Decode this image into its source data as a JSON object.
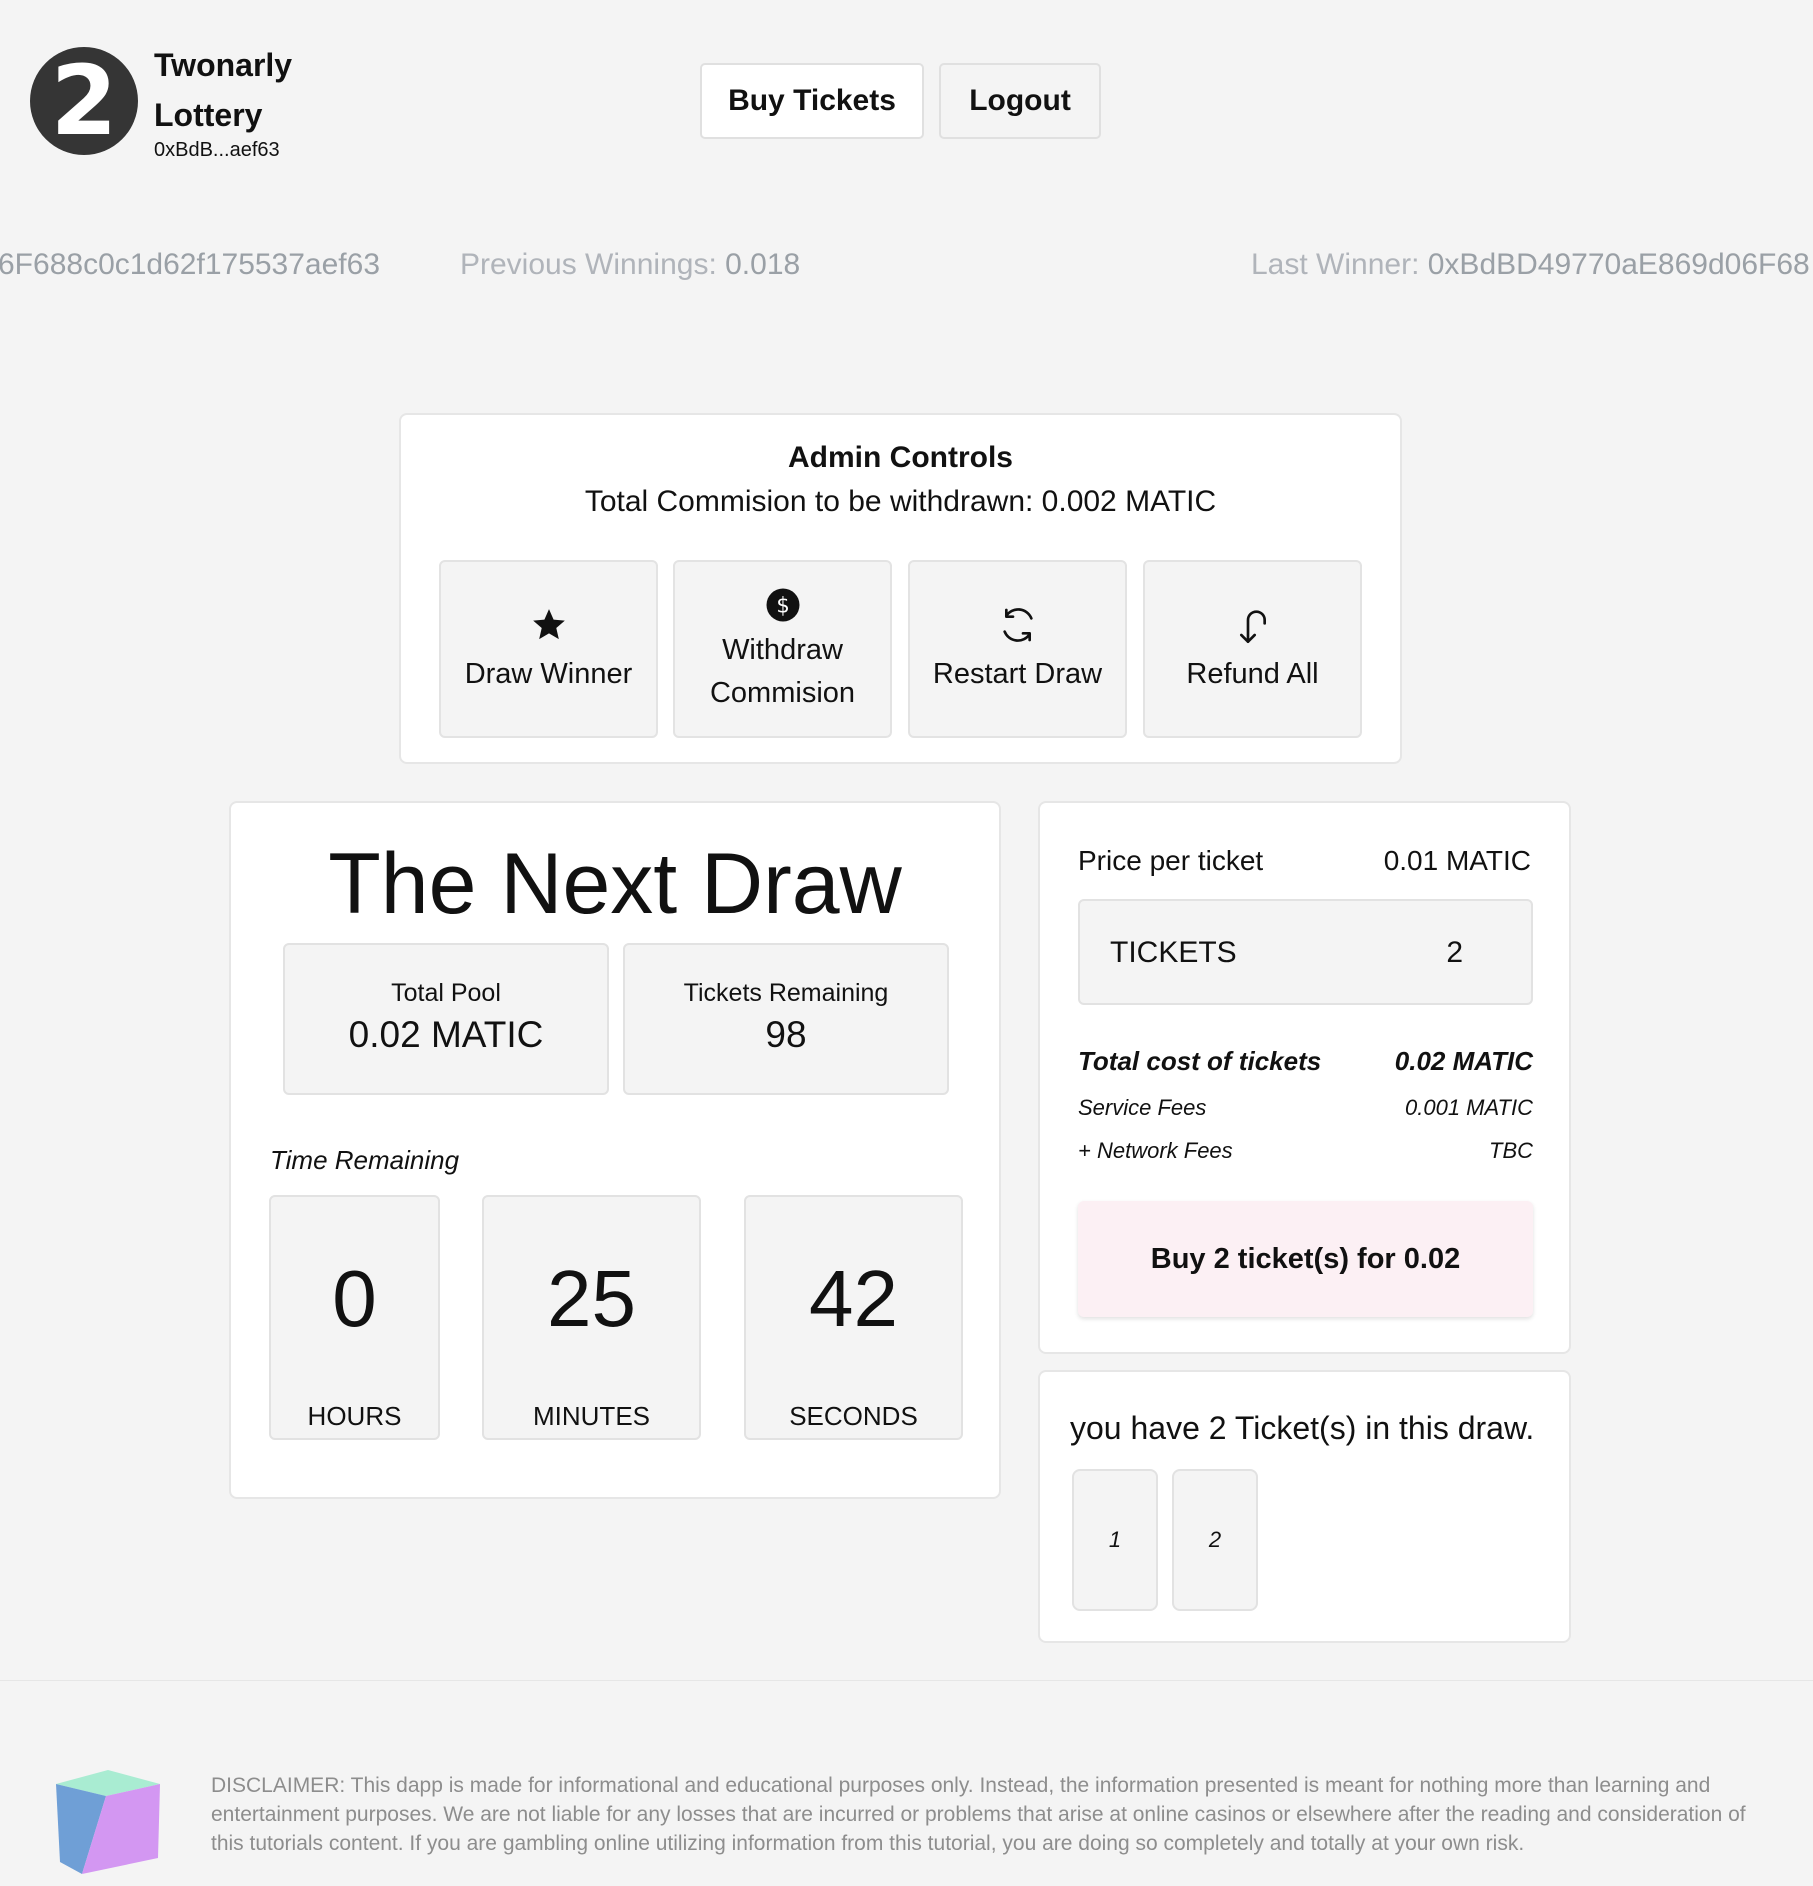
{
  "header": {
    "logo_glyph": "2",
    "app_name": "Twonarly Lottery",
    "account_short": "0xBdB...aef63",
    "buy_tickets_label": "Buy Tickets",
    "logout_label": "Logout"
  },
  "ticker": {
    "address_fragment": "6F688c0c1d62f175537aef63",
    "prev_winnings_label": "Previous Winnings:",
    "prev_winnings_value": "0.018",
    "last_winner_label": "Last Winner:",
    "last_winner_value": "0xBdBD49770aE869d06F68"
  },
  "admin": {
    "title": "Admin Controls",
    "commission_text": "Total Commision to be withdrawn: 0.002 MATIC",
    "buttons": [
      {
        "label": "Draw Winner",
        "icon": "star-icon"
      },
      {
        "label": "Withdraw Commision",
        "icon": "dollar-coin-icon"
      },
      {
        "label": "Restart Draw",
        "icon": "refresh-icon"
      },
      {
        "label": "Refund All",
        "icon": "undo-arrow-icon"
      }
    ]
  },
  "draw": {
    "title": "The Next Draw",
    "total_pool_label": "Total Pool",
    "total_pool_value": "0.02 MATIC",
    "tickets_remaining_label": "Tickets Remaining",
    "tickets_remaining_value": "98",
    "time_remaining_label": "Time Remaining",
    "hours": "0",
    "hours_label": "HOURS",
    "minutes": "25",
    "minutes_label": "MINUTES",
    "seconds": "42",
    "seconds_label": "SECONDS"
  },
  "purchase": {
    "price_label": "Price per ticket",
    "price_value": "0.01 MATIC",
    "tickets_label": "TICKETS",
    "tickets_value": "2",
    "total_cost_label": "Total cost of tickets",
    "total_cost_value": "0.02 MATIC",
    "service_fees_label": "Service Fees",
    "service_fees_value": "0.001 MATIC",
    "network_fees_label": "+ Network Fees",
    "network_fees_value": "TBC",
    "buy_button_label": "Buy 2 ticket(s) for 0.02"
  },
  "my_tickets": {
    "summary": "you have 2 Ticket(s) in this draw.",
    "tickets": [
      "1",
      "2"
    ]
  },
  "footer": {
    "disclaimer": "DISCLAIMER: This dapp is made for informational and educational purposes only. Instead, the information presented is meant for nothing more than learning and entertainment purposes. We are not liable for any losses that are incurred or problems that arise at online casinos or elsewhere after the reading and consideration of this tutorials content. If you are gambling online utilizing information from this tutorial, you are doing so completely and totally at your own risk."
  },
  "colors": {
    "background": "#f4f4f4",
    "logo_circle": "#353535",
    "buy_button_bg": "#fcf0f4",
    "ticker_text": "#b0b4ba"
  }
}
